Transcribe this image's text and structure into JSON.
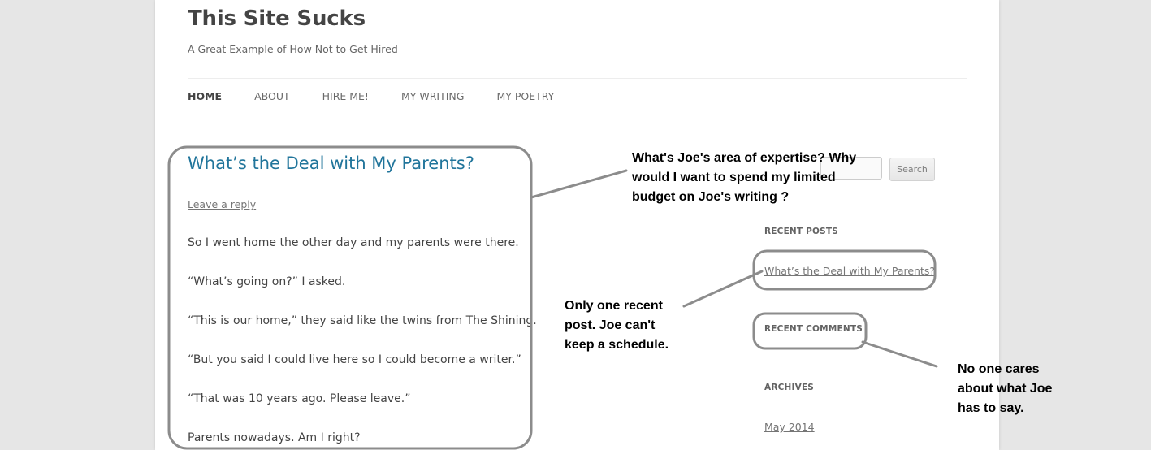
{
  "site": {
    "title": "This Site Sucks",
    "description": "A Great Example of How Not to Get Hired"
  },
  "nav": {
    "items": [
      "HOME",
      "ABOUT",
      "HIRE ME!",
      "MY WRITING",
      "MY POETRY"
    ],
    "active": "HOME"
  },
  "post": {
    "title": "What’s the Deal with My Parents?",
    "leave_reply": "Leave a reply",
    "paragraphs": [
      "So I went home the other day and my parents were there.",
      "“What’s going on?” I asked.",
      "“This is our home,” they said like the twins from The Shining.",
      "“But you said I could live here so I could become a writer.”",
      "“That was 10 years ago. Please leave.”",
      "Parents nowadays. Am I right?"
    ]
  },
  "sidebar": {
    "search_button": "Search",
    "recent_posts_title": "RECENT POSTS",
    "recent_posts": [
      "What’s the Deal with My Parents?"
    ],
    "recent_comments_title": "RECENT COMMENTS",
    "archives_title": "ARCHIVES",
    "archives": [
      "May 2014"
    ]
  },
  "annotations": {
    "expertise": "What's Joe's area of expertise? Why\nwould I want to spend my limited\nbudget on Joe's writing ?",
    "recent_post": "Only one recent\npost. Joe can't\nkeep a schedule.",
    "comments": "No one cares\nabout what Joe\nhas to say."
  },
  "colors": {
    "post_title": "#21759b",
    "annotation_stroke": "#8c8c8c",
    "background": "#e6e6e6"
  }
}
